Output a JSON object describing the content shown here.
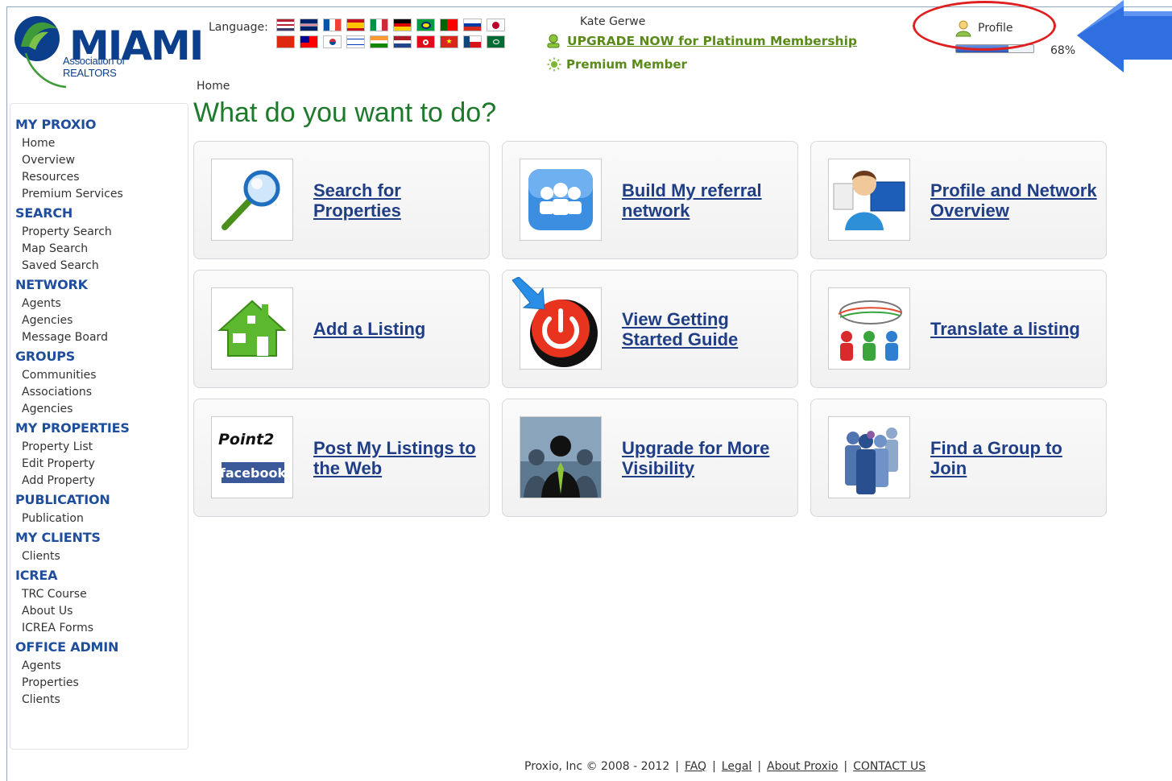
{
  "logo": {
    "word": "MIAMI",
    "subtitle": "Association of REALTORS"
  },
  "header": {
    "language_label": "Language:",
    "user_name": "Kate Gerwe",
    "upgrade_link": "UPGRADE NOW for Platinum Membership",
    "membership": "Premium Member",
    "profile_label": "Profile",
    "profile_progress": "68%",
    "profile_progress_fraction": 0.68
  },
  "flags": [
    "us-flag",
    "uk-flag",
    "france-flag",
    "spain-flag",
    "italy-flag",
    "germany-flag",
    "brazil-flag",
    "portugal-flag",
    "russia-flag",
    "japan-flag",
    "china-flag",
    "taiwan-flag",
    "korea-flag",
    "israel-flag",
    "india-flag",
    "netherlands-flag",
    "turkey-flag",
    "vietnam-flag",
    "czech-flag",
    "saudi-flag"
  ],
  "breadcrumb": "Home",
  "page_title": "What do you want to do?",
  "sidebar": [
    {
      "heading": "MY PROXIO",
      "items": [
        "Home",
        "Overview",
        "Resources",
        "Premium Services"
      ]
    },
    {
      "heading": "SEARCH",
      "items": [
        "Property Search",
        "Map Search",
        "Saved Search"
      ]
    },
    {
      "heading": "NETWORK",
      "items": [
        "Agents",
        "Agencies",
        "Message Board"
      ]
    },
    {
      "heading": "GROUPS",
      "items": [
        "Communities",
        "Associations",
        "Agencies"
      ]
    },
    {
      "heading": "MY PROPERTIES",
      "items": [
        "Property List",
        "Edit Property",
        "Add Property"
      ]
    },
    {
      "heading": "PUBLICATION",
      "items": [
        "Publication"
      ]
    },
    {
      "heading": "MY CLIENTS",
      "items": [
        "Clients"
      ]
    },
    {
      "heading": "ICREA",
      "items": [
        "TRC Course",
        "About Us",
        "ICREA Forms"
      ]
    },
    {
      "heading": "OFFICE ADMIN",
      "items": [
        "Agents",
        "Properties",
        "Clients"
      ]
    }
  ],
  "tiles": [
    {
      "label": "Search for Properties",
      "icon": "magnifier-icon"
    },
    {
      "label": "Build My referral network",
      "icon": "people-network-icon"
    },
    {
      "label": "Profile and Network Overview",
      "icon": "profile-monitor-icon"
    },
    {
      "label": "Add a Listing",
      "icon": "house-icon"
    },
    {
      "label": "View Getting Started Guide",
      "icon": "power-button-icon"
    },
    {
      "label": "Translate a listing",
      "icon": "translate-people-icon"
    },
    {
      "label": "Post My Listings to the Web",
      "icon": "point2-facebook-icon",
      "image_text": [
        "Point2",
        "facebook"
      ]
    },
    {
      "label": "Upgrade for More Visibility",
      "icon": "businessman-icon"
    },
    {
      "label": "Find a Group to Join",
      "icon": "group-people-icon"
    }
  ],
  "footer": {
    "copyright": "Proxio, Inc © 2008 - 2012",
    "links": [
      "FAQ",
      "Legal",
      "About Proxio",
      "CONTACT US"
    ]
  },
  "colors": {
    "brand_blue": "#1f4e9c",
    "title_green": "#1e7a2b",
    "link_navy": "#1f3e86",
    "upgrade_green": "#5a8a1a",
    "highlight_red": "#e02020",
    "arrow_blue": "#2f6fe0"
  }
}
